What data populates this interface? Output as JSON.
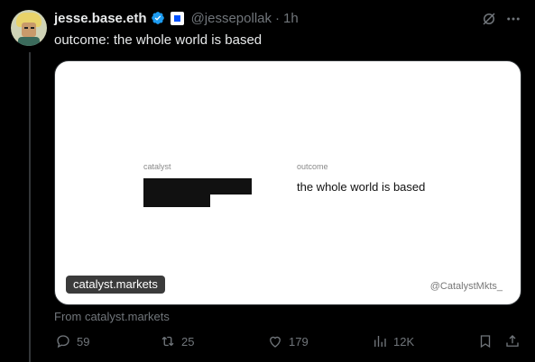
{
  "tweet": {
    "author_name": "jesse.base.eth",
    "handle": "@jessepollak",
    "separator": "·",
    "time": "1h",
    "text": "outcome: the whole world is based",
    "source": "From catalyst.markets"
  },
  "card": {
    "catalyst_label": "catalyst",
    "outcome_label": "outcome",
    "outcome_value": "the whole world is based",
    "watermark_handle": "@CatalystMkts_",
    "domain": "catalyst.markets"
  },
  "actions": {
    "replies": "59",
    "reposts": "25",
    "likes": "179",
    "views": "12K"
  },
  "colors": {
    "background": "#000000",
    "text": "#e7e9ea",
    "muted": "#71767b",
    "verified": "#1d9bf0",
    "base_blue": "#0052ff",
    "card_bg": "#ffffff"
  },
  "icons": [
    "verified-badge-icon",
    "base-affiliate-icon",
    "grok-icon",
    "more-icon",
    "reply-icon",
    "retweet-icon",
    "like-icon",
    "views-icon",
    "bookmark-icon",
    "share-icon"
  ]
}
